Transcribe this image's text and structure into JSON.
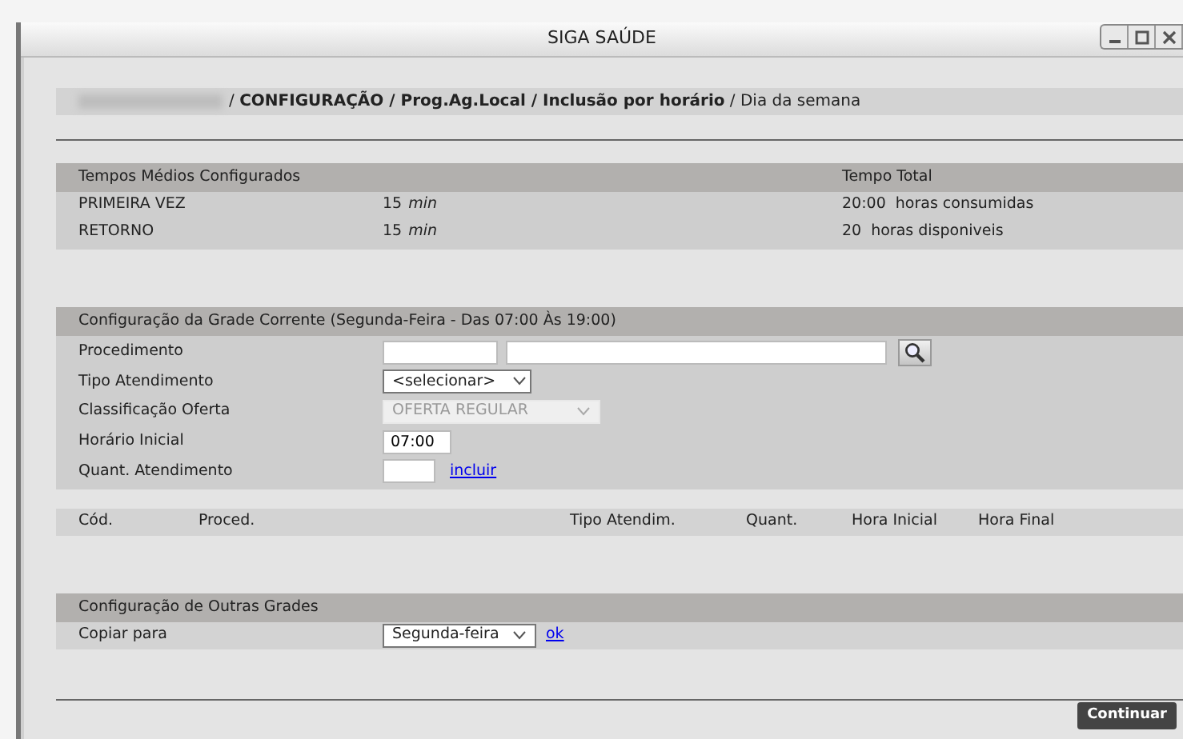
{
  "window": {
    "title": "SIGA SAÚDE"
  },
  "breadcrumb": "/ **CONFIGURAÇÃO / Prog.Ag.Local / Inclusão por horário** / Dia da semana",
  "times": {
    "columns": [
      "Tempos Médios Configurados",
      "Tempo Total"
    ],
    "rows": [
      {
        "label": "PRIMEIRA VEZ",
        "value": "15",
        "unit": "min",
        "total": "20:00",
        "total_label": "horas consumidas"
      },
      {
        "label": "RETORNO",
        "value": "15",
        "unit": "min",
        "total": "20",
        "total_label": "horas disponiveis"
      }
    ]
  },
  "grade": {
    "title": "Configuração da Grade Corrente (Segunda-Feira - Das 07:00 Às 19:00)",
    "fields": [
      {
        "kind": "search",
        "label": "Procedimento"
      },
      {
        "kind": "select",
        "label": "Tipo Atendimento",
        "value": "<selecionar>",
        "disabled": false
      },
      {
        "kind": "select",
        "label": "Classificação Oferta",
        "value": "OFERTA REGULAR",
        "disabled": true
      },
      {
        "kind": "text",
        "label": "Horário Inicial",
        "value": "07:00"
      },
      {
        "kind": "text_link",
        "label": "Quant. Atendimento",
        "link": "incluir"
      }
    ]
  },
  "table": {
    "columns": [
      "Cód.",
      "Proced.",
      "Tipo Atendim.",
      "Quant.",
      "Hora Inicial",
      "Hora Final"
    ]
  },
  "other": {
    "title": "Configuração de Outras Grades",
    "rows": [
      {
        "label": "Copiar para",
        "value": "Segunda-feira",
        "link": "ok"
      }
    ]
  },
  "buttons": [
    "Continuar"
  ]
}
